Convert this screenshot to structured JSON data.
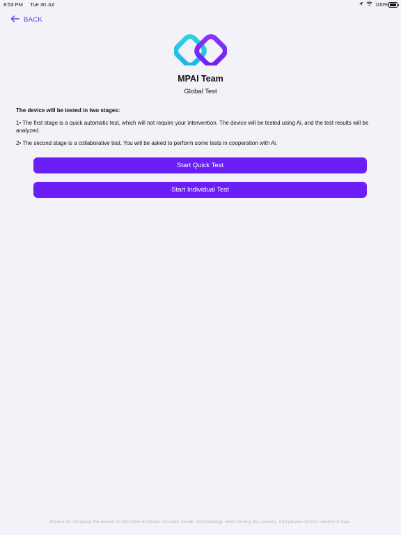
{
  "status_bar": {
    "time": "8:53 PM",
    "date": "Tue 30 Jul",
    "battery": "100%",
    "battery_level": 1.0
  },
  "nav": {
    "back_label": "BACK",
    "back_icon": "arrow-left-icon"
  },
  "logo": {
    "icon": "mpai-logo",
    "colors": [
      "#29c6e6",
      "#7b2ff7"
    ]
  },
  "header": {
    "team_name": "MPAI Team",
    "subtitle": "Global Test"
  },
  "intro": {
    "heading": "The device will be tested in two stages:",
    "stage1": "1• The first stage is a quick automatic test, which will not require your intervention. The device will be tested using Ai, and the test results will be analyzed.",
    "stage2": "2• The second stage is a collaborative test. You will be asked to perform some tests in cooperation with Ai."
  },
  "buttons": {
    "quick": "Start Quick Test",
    "individual": "Start Individual Test"
  },
  "footer": {
    "note": "Please do not place the device on the table to obtain accurate results and readings when testing the camera, And please set the volume to max."
  },
  "colors": {
    "accent": "#6b1ff6",
    "background": "#f3f2f8"
  }
}
